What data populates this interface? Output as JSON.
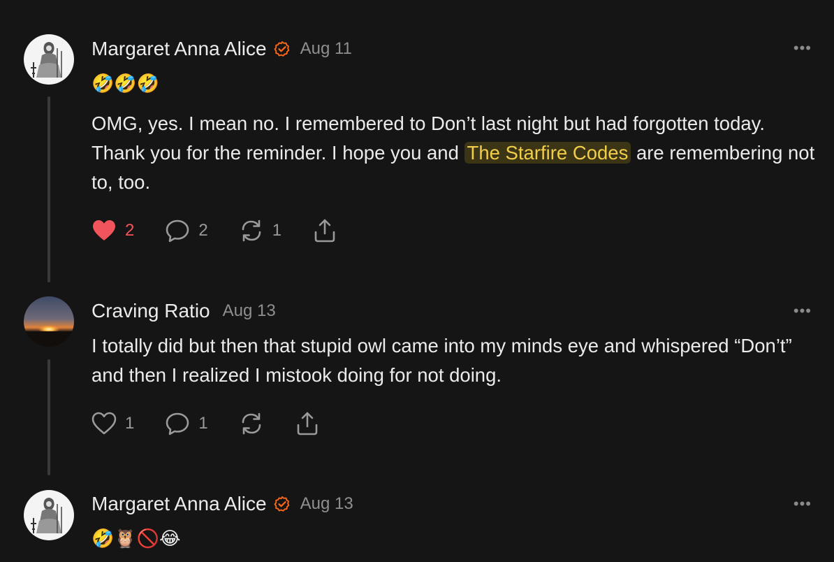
{
  "comments": [
    {
      "author": "Margaret Anna Alice",
      "verified": true,
      "date": "Aug 11",
      "emoji_line": "🤣🤣🤣",
      "text_before": "OMG, yes. I mean no. I remembered to Don’t last night but had forgotten today. Thank you for the reminder. I hope you and ",
      "mention": "The Starfire Codes",
      "text_after": " are remembering not to, too.",
      "likes": "2",
      "liked": true,
      "replies": "2",
      "restacks": "1",
      "more_label": "•••"
    },
    {
      "author": "Craving Ratio",
      "verified": false,
      "date": "Aug 13",
      "text": "I totally did but then that stupid owl came into my minds eye and whispered “Don’t” and then I realized I mistook doing for not doing.",
      "likes": "1",
      "liked": false,
      "replies": "1",
      "more_label": "•••"
    },
    {
      "author": "Margaret Anna Alice",
      "verified": true,
      "date": "Aug 13",
      "emoji_line": "🤣🦉🚫😂",
      "more_label": "•••"
    }
  ],
  "colors": {
    "background": "#151515",
    "verified_badge": "#ff6719",
    "liked_heart": "#f2545b",
    "mention_bg": "#3b3415",
    "mention_text": "#f1cd4a"
  },
  "icons": {
    "like": "heart-icon",
    "reply": "speech-bubble-icon",
    "restack": "restack-arrows-icon",
    "share": "share-upload-icon",
    "more": "ellipsis-icon",
    "verified": "check-badge-icon"
  }
}
